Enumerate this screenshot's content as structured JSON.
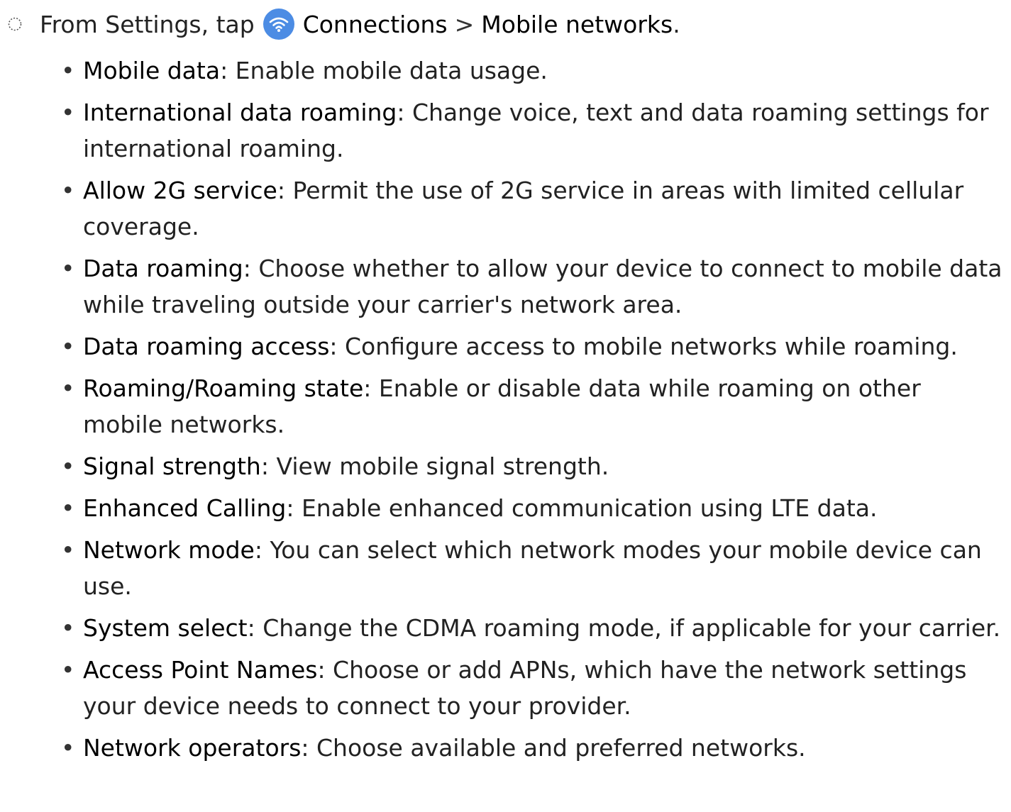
{
  "intro": {
    "prefix": "From Settings, tap",
    "connections_label": "Connections",
    "separator": ">",
    "mobile_networks_label": "Mobile networks",
    "suffix": ".",
    "connections_icon": "wifi-icon",
    "icon_color": "#4c8ce4"
  },
  "items": [
    {
      "term": "Mobile data",
      "desc": ": Enable mobile data usage."
    },
    {
      "term": "International data roaming",
      "desc": ": Change voice, text and data roaming settings for international roaming."
    },
    {
      "term": "Allow 2G service",
      "desc": ": Permit the use of 2G service in areas with limited cellular coverage."
    },
    {
      "term": "Data roaming",
      "desc": ": Choose whether to allow your device to connect to mobile data while traveling outside your carrier's network area."
    },
    {
      "term": "Data roaming access",
      "desc": ": Configure access to mobile networks while roaming."
    },
    {
      "term": "Roaming/Roaming state",
      "desc": ": Enable or disable data while roaming on other mobile networks."
    },
    {
      "term": "Signal strength",
      "desc": ": View mobile signal strength."
    },
    {
      "term": "Enhanced Calling",
      "desc": ": Enable enhanced communication using LTE data."
    },
    {
      "term": "Network mode",
      "desc": ": You can select which network modes your mobile device can use."
    },
    {
      "term": "System select",
      "desc": ": Change the CDMA roaming mode, if applicable for your carrier."
    },
    {
      "term": "Access Point Names",
      "desc": ": Choose or add APNs, which have the network settings your device needs to connect to your provider."
    },
    {
      "term": "Network operators",
      "desc": ": Choose available and preferred networks."
    }
  ]
}
